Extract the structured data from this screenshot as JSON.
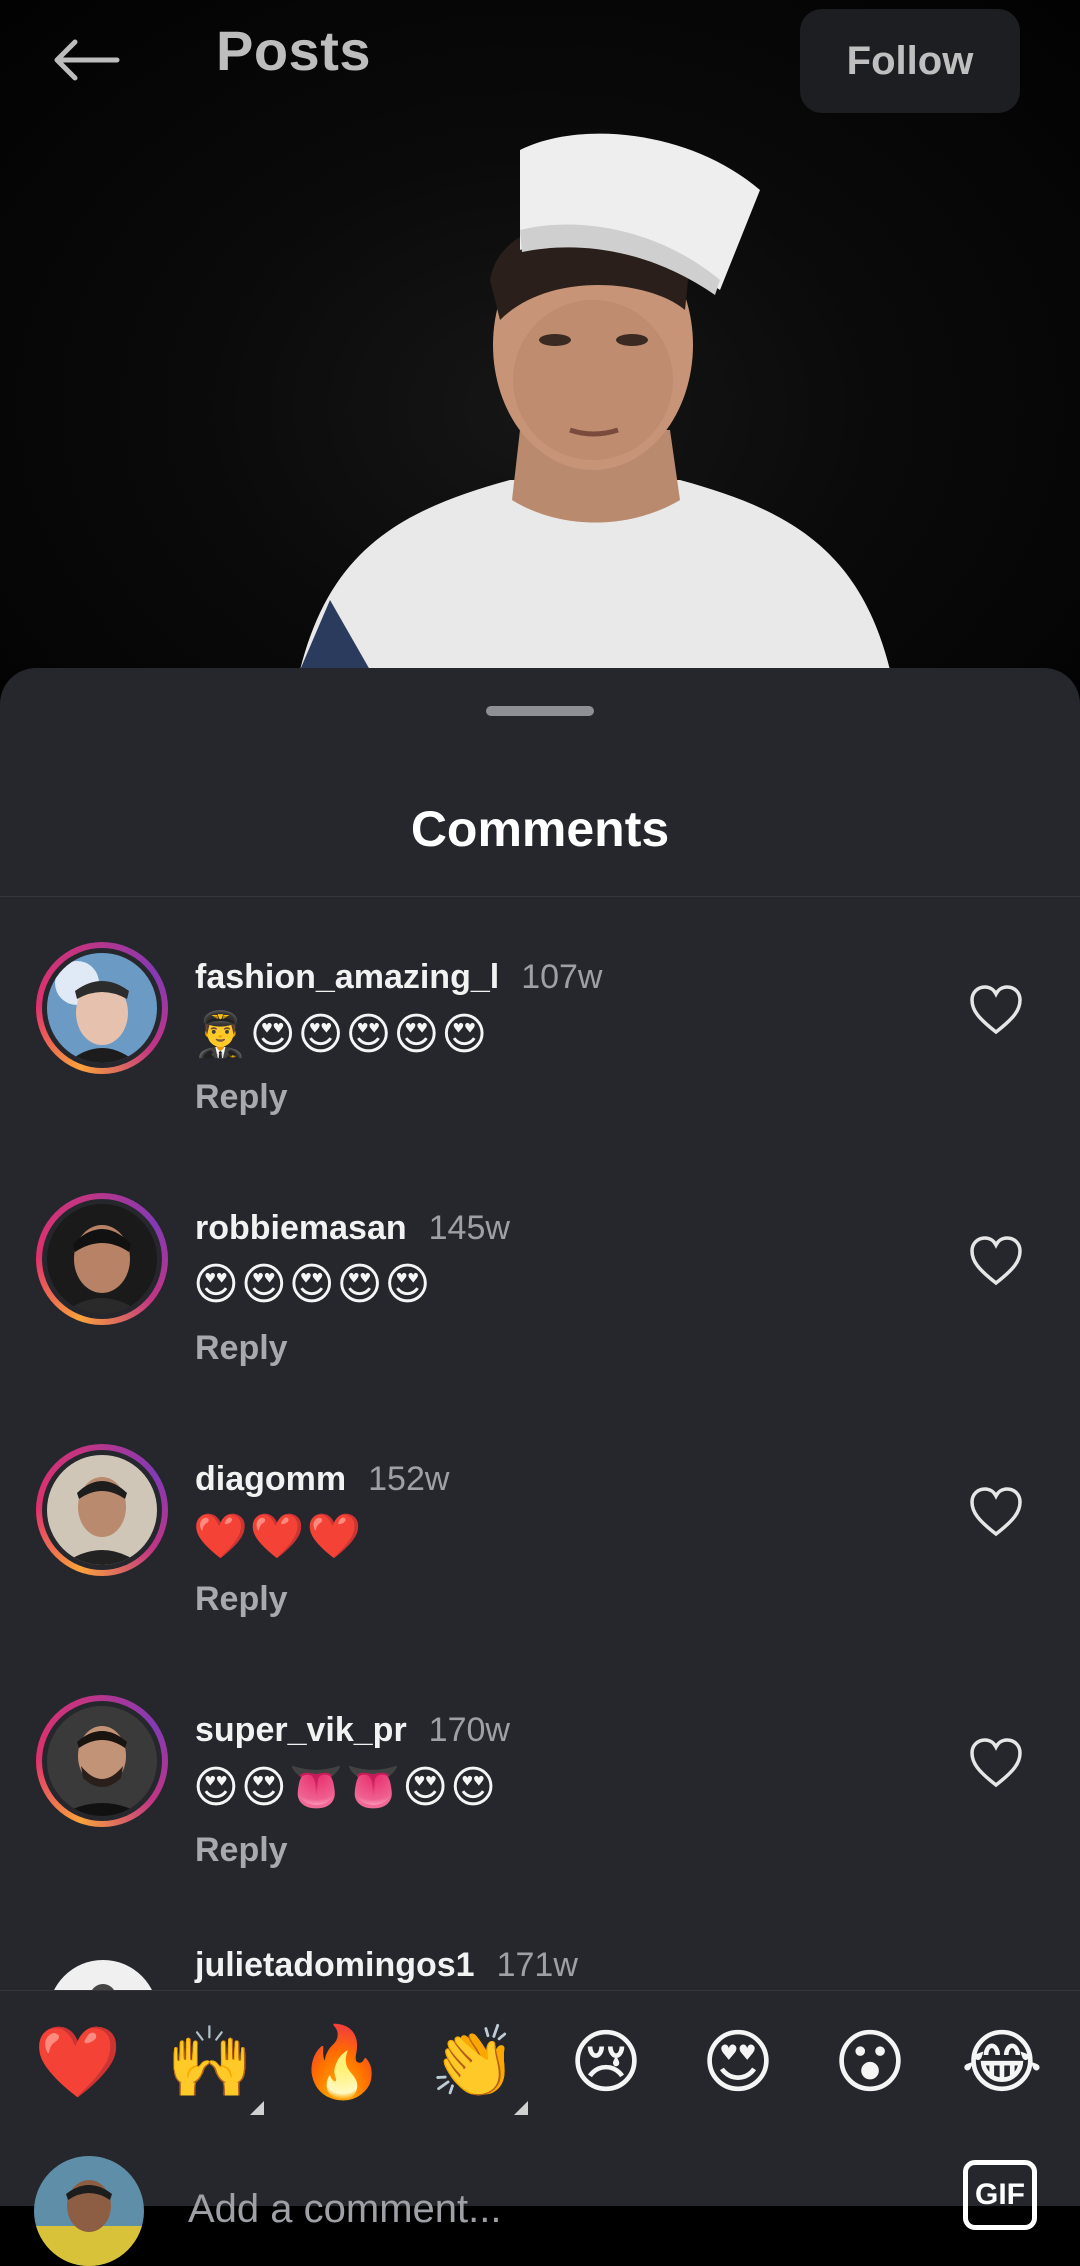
{
  "header": {
    "title": "Posts",
    "follow_label": "Follow"
  },
  "comments_sheet": {
    "title": "Comments",
    "comments": [
      {
        "user": "fashion_amazing_l",
        "time": "107w",
        "text": "👨‍✈️😍😍😍😍😍",
        "reply": "Reply"
      },
      {
        "user": "robbiemasan",
        "time": "145w",
        "text": "😍😍😍😍😍",
        "reply": "Reply"
      },
      {
        "user": "diagomm",
        "time": "152w",
        "text": "❤️❤️❤️",
        "reply": "Reply"
      },
      {
        "user": "super_vik_pr",
        "time": "170w",
        "text": "😍😍👅👅😍😍",
        "reply": "Reply"
      },
      {
        "user": "julietadomingos1",
        "time": "171w"
      }
    ]
  },
  "quick_reactions": [
    "❤️",
    "🙌",
    "🔥",
    "👏",
    "😢",
    "😍",
    "😮",
    "😂"
  ],
  "composer": {
    "placeholder": "Add a comment...",
    "gif_label": "GIF"
  },
  "colors": {
    "sheet_bg": "#25272d",
    "page_bg": "#000000",
    "story_ring": [
      "#f9a23c",
      "#e1306c",
      "#833ab4"
    ]
  }
}
